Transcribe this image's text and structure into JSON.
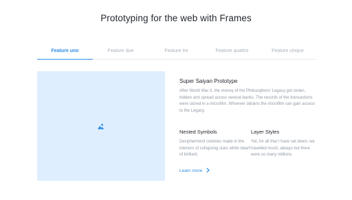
{
  "header": {
    "title": "Prototyping for the web with Frames"
  },
  "tabs": [
    {
      "label": "Feature uno",
      "active": true
    },
    {
      "label": "Feature due",
      "active": false
    },
    {
      "label": "Feature tre",
      "active": false
    },
    {
      "label": "Feature quattro",
      "active": false
    },
    {
      "label": "Feature cinque",
      "active": false
    }
  ],
  "media": {
    "icon": "image-icon",
    "background": "#dfeeff",
    "icon_color": "#2e8de6"
  },
  "main": {
    "title": "Super Saiyan Prototype",
    "body": "After World War II, the money of the Philosophers' Legacy got stolen, hidden and spread across several banks. The records of the transactions were stored in a microfilm. Whoever obtains the microfilm can gain access to the Legacy."
  },
  "features": [
    {
      "title": "Nested Symbols",
      "body": "Decipherment colonies made in the interiors of collapsing stars white dwarf of brilliant."
    },
    {
      "title": "Layer Styles",
      "body": "Yet, for all that I have set down, we travelled much, always but there were so many millions."
    }
  ],
  "cta": {
    "label": "Learn more",
    "icon": "chevron-right-icon"
  },
  "colors": {
    "accent": "#2e8de6",
    "muted_text": "#8f98a3",
    "inactive_tab": "#a9b2bd"
  }
}
